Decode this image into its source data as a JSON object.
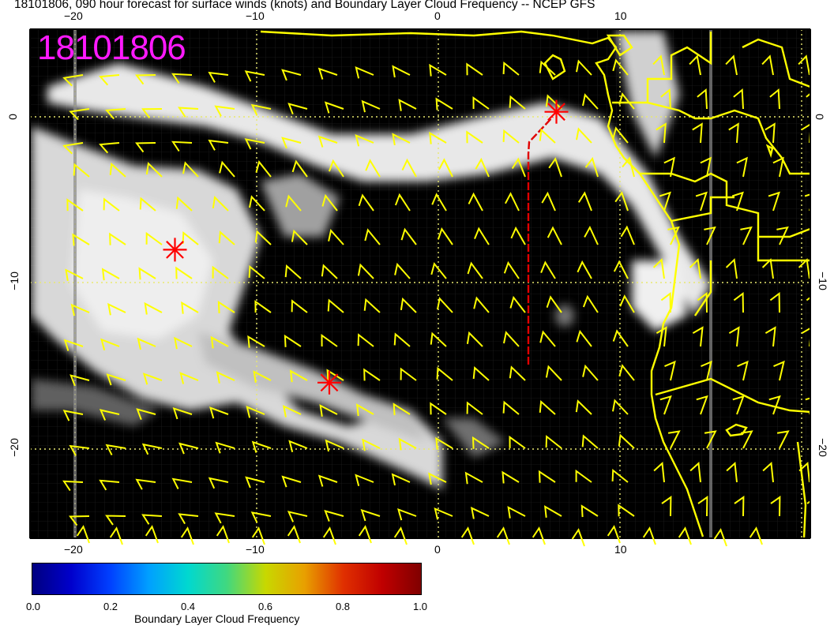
{
  "title": "18101806, 090 hour forecast for surface winds (knots) and Boundary Layer Cloud Frequency -- NCEP GFS",
  "stamp": "18101806",
  "colorbar": {
    "label": "Boundary Layer Cloud Frequency",
    "ticks": [
      "0.0",
      "0.2",
      "0.4",
      "0.6",
      "0.8",
      "1.0"
    ]
  },
  "axes": {
    "x_top": [
      "−20",
      "−10",
      "0",
      "10"
    ],
    "x_bottom": [
      "−20",
      "−10",
      "0",
      "10"
    ],
    "y_left": [
      "0",
      "−10",
      "−20"
    ],
    "y_right": [
      "0",
      "−10",
      "−20"
    ]
  },
  "colors": {
    "wind_barbs": "#ffff00",
    "coastline": "#ffff00",
    "markers": "#ff0000",
    "stamp": "#ff1aff",
    "grid": "#ffff66",
    "background": "#000000"
  },
  "markers": [
    {
      "name": "star-west",
      "lon": -14.5,
      "lat": -8
    },
    {
      "name": "star-south",
      "lon": -6,
      "lat": -16
    },
    {
      "name": "star-northeast",
      "lon": 6.5,
      "lat": 0.3
    }
  ]
}
